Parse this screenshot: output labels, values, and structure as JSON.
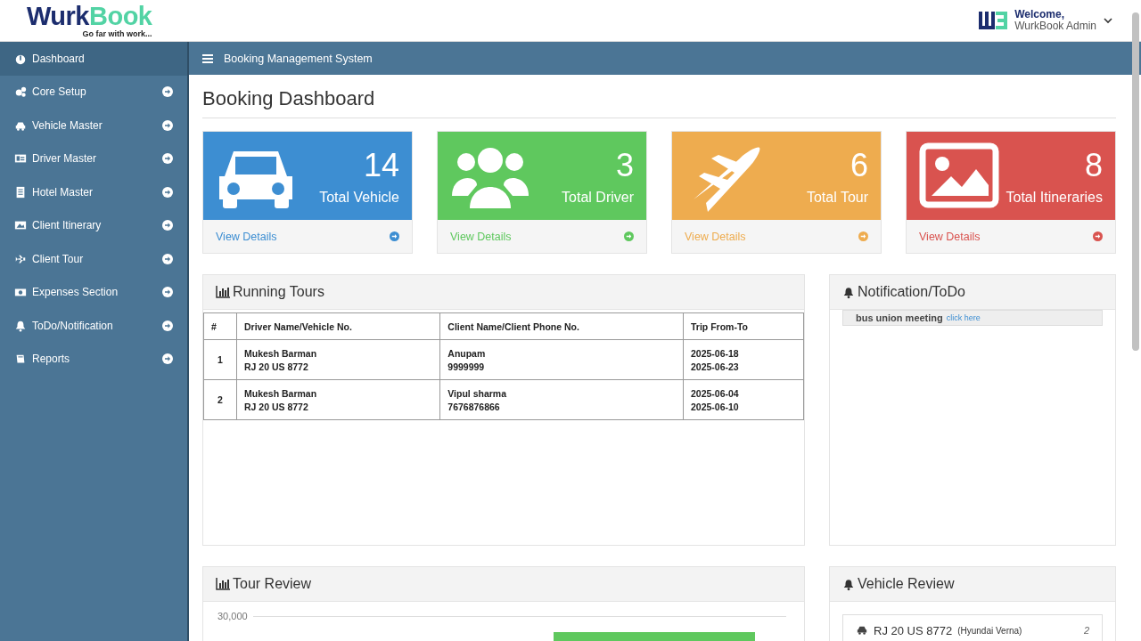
{
  "brand": {
    "name_part_1": "Wurk",
    "name_part_2": "Book",
    "tagline": "Go far with work..."
  },
  "user": {
    "greeting": "Welcome,",
    "name": "WurkBook Admin"
  },
  "topbar": {
    "title": "Booking Management System"
  },
  "sidebar": {
    "items": [
      {
        "label": "Dashboard",
        "selected": true,
        "expandable": false
      },
      {
        "label": "Core Setup",
        "selected": false,
        "expandable": true
      },
      {
        "label": "Vehicle Master",
        "selected": false,
        "expandable": true
      },
      {
        "label": "Driver Master",
        "selected": false,
        "expandable": true
      },
      {
        "label": "Hotel Master",
        "selected": false,
        "expandable": true
      },
      {
        "label": "Client Itinerary",
        "selected": false,
        "expandable": true
      },
      {
        "label": "Client Tour",
        "selected": false,
        "expandable": true
      },
      {
        "label": "Expenses Section",
        "selected": false,
        "expandable": true
      },
      {
        "label": "ToDo/Notification",
        "selected": false,
        "expandable": true
      },
      {
        "label": "Reports",
        "selected": false,
        "expandable": true
      }
    ]
  },
  "page": {
    "title": "Booking Dashboard"
  },
  "stats": [
    {
      "count": "14",
      "label": "Total Vehicle",
      "link": "View Details",
      "color": "#3d8ed2"
    },
    {
      "count": "3",
      "label": "Total Driver",
      "link": "View Details",
      "color": "#5fc85e"
    },
    {
      "count": "6",
      "label": "Total Tour",
      "link": "View Details",
      "color": "#eeac4f"
    },
    {
      "count": "8",
      "label": "Total Itineraries",
      "link": "View Details",
      "color": "#d9534f"
    }
  ],
  "running_tours": {
    "title": "Running Tours",
    "columns": [
      "#",
      "Driver Name/Vehicle No.",
      "Client Name/Client Phone No.",
      "Trip From-To"
    ],
    "rows": [
      {
        "index": "1",
        "driver": "Mukesh Barman",
        "vehicle": "RJ 20 US 8772",
        "client": "Anupam",
        "phone": "9999999",
        "from": "2025-06-18",
        "to": "2025-06-23"
      },
      {
        "index": "2",
        "driver": "Mukesh Barman",
        "vehicle": "RJ 20 US 8772",
        "client": "Vipul sharma",
        "phone": "7676876866",
        "from": "2025-06-04",
        "to": "2025-06-10"
      }
    ]
  },
  "notifications": {
    "title": "Notification/ToDo",
    "items": [
      {
        "text": "bus union meeting",
        "link": "click here"
      }
    ]
  },
  "tour_review": {
    "title": "Tour Review",
    "tick": "30,000"
  },
  "vehicle_review": {
    "title": "Vehicle Review",
    "items": [
      {
        "plate": "RJ 20 US 8772",
        "model": "(Hyundai Verna)",
        "count": "2"
      }
    ]
  }
}
